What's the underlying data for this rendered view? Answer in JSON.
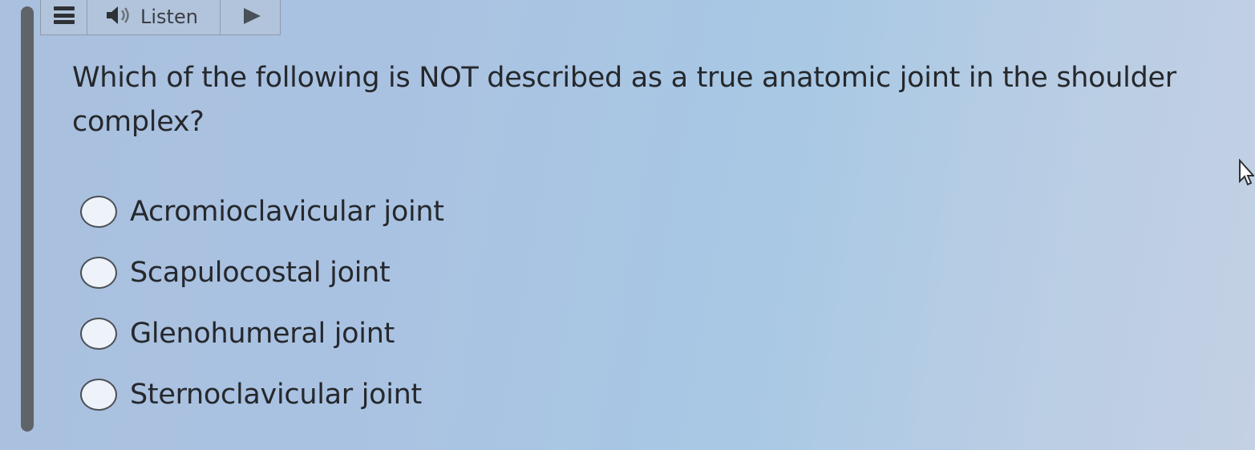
{
  "toolbar": {
    "menu_icon": "hamburger-menu-icon",
    "speaker_icon": "speaker-icon",
    "listen_label": "Listen",
    "play_icon": "play-icon"
  },
  "question": {
    "text": "Which of the following is NOT described as a true anatomic joint in the shoulder complex?"
  },
  "options": [
    {
      "label": "Acromioclavicular joint",
      "selected": false
    },
    {
      "label": "Scapulocostal joint",
      "selected": false
    },
    {
      "label": "Glenohumeral joint",
      "selected": false
    },
    {
      "label": "Sternoclavicular joint",
      "selected": false
    }
  ],
  "cursor_icon": "mouse-pointer-icon",
  "colors": {
    "text": "#25282c",
    "play": "#4a5058"
  }
}
